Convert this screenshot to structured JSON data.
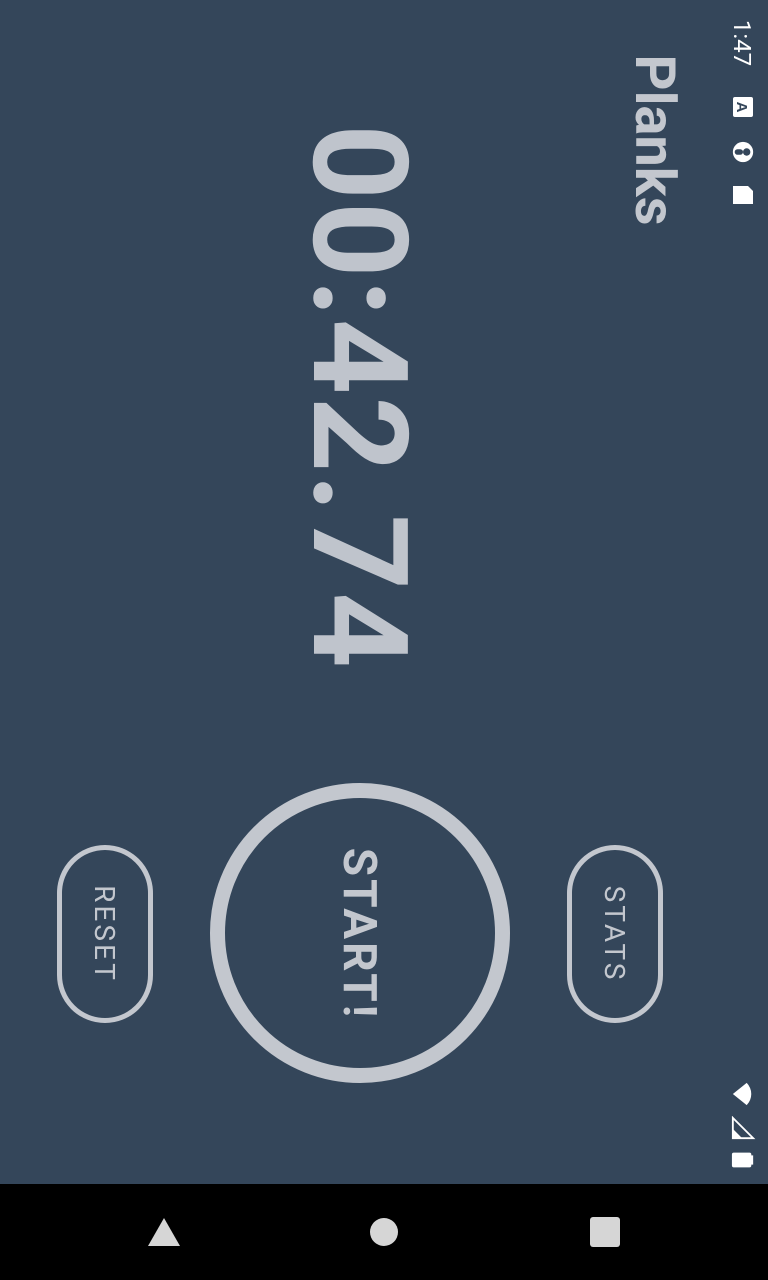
{
  "status_bar": {
    "time": "1:47",
    "icons_left": [
      "text-a-icon",
      "podcast-icon",
      "sd-card-icon"
    ],
    "icons_right": [
      "wifi-icon",
      "signal-icon",
      "battery-icon"
    ]
  },
  "app": {
    "title": "Planks",
    "timer": "00:42.74"
  },
  "controls": {
    "start_label": "START!",
    "reset_label": "RESET",
    "stats_label": "STATS"
  },
  "navigation": {
    "back": "back-triangle-icon",
    "home": "home-circle-icon",
    "recent": "recents-square-icon"
  },
  "colors": {
    "background": "#34465a",
    "foreground": "#c3c7ce",
    "nav_bar": "#000000"
  }
}
